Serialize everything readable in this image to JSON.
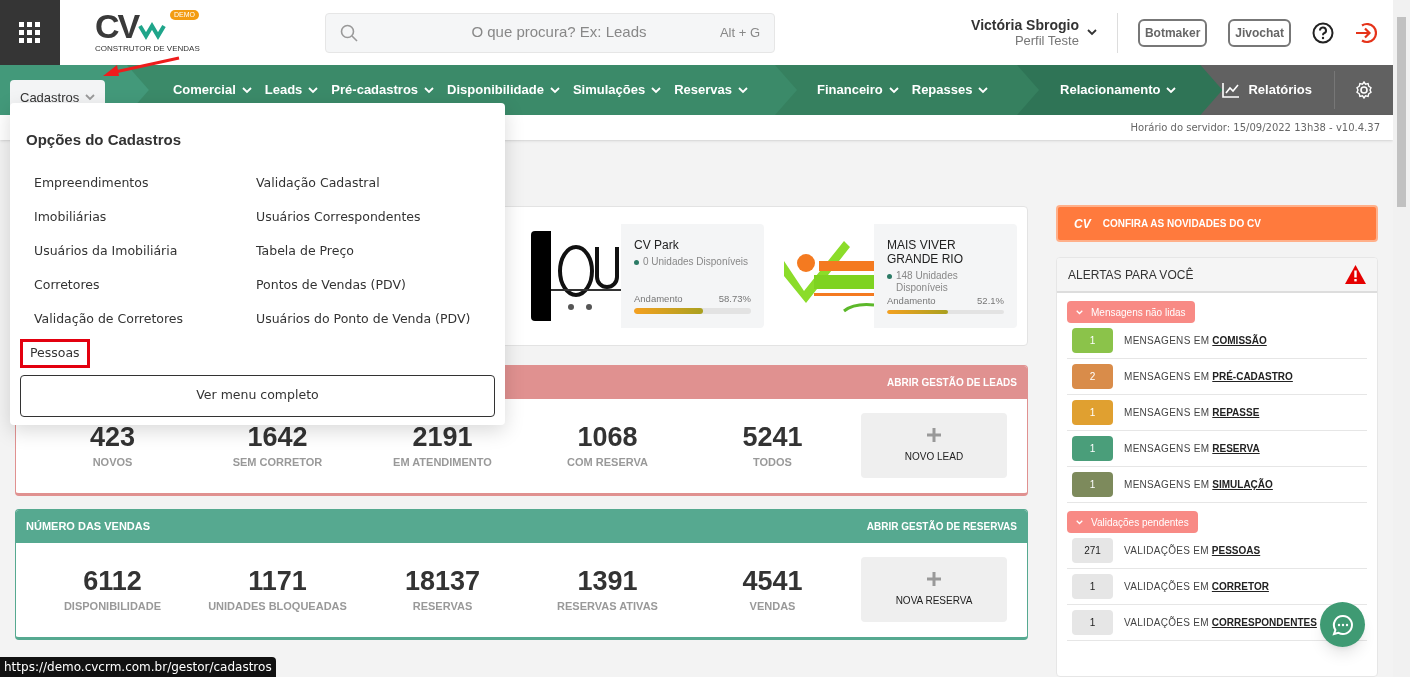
{
  "header": {
    "logo": "CV",
    "logo_badge": "DEMO",
    "logo_tagline": "CONSTRUTOR DE VENDAS",
    "search": {
      "placeholder": "O que procura? Ex: Leads",
      "shortcut": "Alt + G"
    },
    "user": {
      "name": "Victória Sbrogio",
      "profile": "Perfil Teste"
    },
    "buttons": [
      "Botmaker",
      "Jivochat"
    ]
  },
  "nav": {
    "segments": [
      {
        "items": [
          {
            "label": "Cadastros",
            "selected": true
          }
        ]
      },
      {
        "items": [
          {
            "label": "Comercial",
            "selected": false
          },
          {
            "label": "Leads",
            "selected": false
          },
          {
            "label": "Pré-cadastros",
            "selected": false
          },
          {
            "label": "Disponibilidade",
            "selected": false
          },
          {
            "label": "Simulações",
            "selected": false
          },
          {
            "label": "Reservas",
            "selected": false
          }
        ]
      },
      {
        "items": [
          {
            "label": "Financeiro",
            "selected": false
          },
          {
            "label": "Repasses",
            "selected": false
          }
        ]
      },
      {
        "items": [
          {
            "label": "Relacionamento",
            "selected": false
          }
        ]
      }
    ],
    "reports": "Relatórios"
  },
  "server_time": "Horário do servidor: 15/09/2022 13h38 - v10.4.37",
  "dropdown": {
    "title": "Opções do Cadastros",
    "columns": [
      {
        "items": [
          {
            "label": "Empreendimentos",
            "highlighted": false
          },
          {
            "label": "Imobiliárias",
            "highlighted": false
          },
          {
            "label": "Usuários da Imobiliária",
            "highlighted": false
          },
          {
            "label": "Corretores",
            "highlighted": false
          },
          {
            "label": "Validação de Corretores",
            "highlighted": false
          },
          {
            "label": "Pessoas",
            "highlighted": true
          }
        ]
      },
      {
        "items": [
          {
            "label": "Validação Cadastral",
            "highlighted": false
          },
          {
            "label": "Usuários Correspondentes",
            "highlighted": false
          },
          {
            "label": "Tabela de Preço",
            "highlighted": false
          },
          {
            "label": "Pontos de Vendas (PDV)",
            "highlighted": false
          },
          {
            "label": "Usuários do Ponto de Venda (PDV)",
            "highlighted": false
          }
        ]
      }
    ],
    "button": "Ver menu completo"
  },
  "projects": [
    {
      "name": "CV Park",
      "units": "0 Unidades Disponíveis",
      "progress_label": "Andamento",
      "progress_value": "58.73%",
      "level": 0.5873
    },
    {
      "name": "MAIS VIVER GRANDE RIO",
      "units": "148 Unidades Disponíveis",
      "progress_label": "Andamento",
      "progress_value": "52.1%",
      "level": 0.521
    }
  ],
  "leads": {
    "link": "ABRIR GESTÃO DE LEADS",
    "stats": [
      {
        "value": "423",
        "label": "NOVOS"
      },
      {
        "value": "1642",
        "label": "SEM CORRETOR"
      },
      {
        "value": "2191",
        "label": "EM ATENDIMENTO"
      },
      {
        "value": "1068",
        "label": "COM RESERVA"
      },
      {
        "value": "5241",
        "label": "TODOS"
      }
    ],
    "action": "NOVO LEAD"
  },
  "sales": {
    "title": "NÚMERO DAS VENDAS",
    "link": "ABRIR GESTÃO DE RESERVAS",
    "stats": [
      {
        "value": "6112",
        "label": "DISPONIBILIDADE"
      },
      {
        "value": "1171",
        "label": "UNIDADES BLOQUEADAS"
      },
      {
        "value": "18137",
        "label": "RESERVAS"
      },
      {
        "value": "1391",
        "label": "RESERVAS ATIVAS"
      },
      {
        "value": "4541",
        "label": "VENDAS"
      }
    ],
    "action": "NOVA RESERVA"
  },
  "news": {
    "logo": "CV",
    "label": "CONFIRA AS NOVIDADES DO CV"
  },
  "alerts": {
    "title": "ALERTAS PARA VOCÊ",
    "groups": [
      {
        "label": "Mensagens não lidas",
        "items": [
          {
            "count": "1",
            "prefix": "MENSAGENS EM",
            "link": "COMISSÃO",
            "color": "#8bc34a"
          },
          {
            "count": "2",
            "prefix": "MENSAGENS EM",
            "link": "PRÉ-CADASTRO",
            "color": "#d98c4a"
          },
          {
            "count": "1",
            "prefix": "MENSAGENS EM",
            "link": "REPASSE",
            "color": "#e0a030"
          },
          {
            "count": "1",
            "prefix": "MENSAGENS EM",
            "link": "RESERVA",
            "color": "#4a9e7a"
          },
          {
            "count": "1",
            "prefix": "MENSAGENS EM",
            "link": "SIMULAÇÃO",
            "color": "#7d8a5c"
          }
        ]
      },
      {
        "label": "Validações pendentes",
        "items": [
          {
            "count": "271",
            "prefix": "VALIDAÇÕES EM",
            "link": "PESSOAS",
            "color": "#e6e6e6"
          },
          {
            "count": "1",
            "prefix": "VALIDAÇÕES EM",
            "link": "CORRETOR",
            "color": "#e6e6e6"
          },
          {
            "count": "1",
            "prefix": "VALIDAÇÕES EM",
            "link": "CORRESPONDENTES",
            "color": "#e6e6e6"
          }
        ]
      }
    ]
  },
  "status_url": "https://demo.cvcrm.com.br/gestor/cadastros"
}
